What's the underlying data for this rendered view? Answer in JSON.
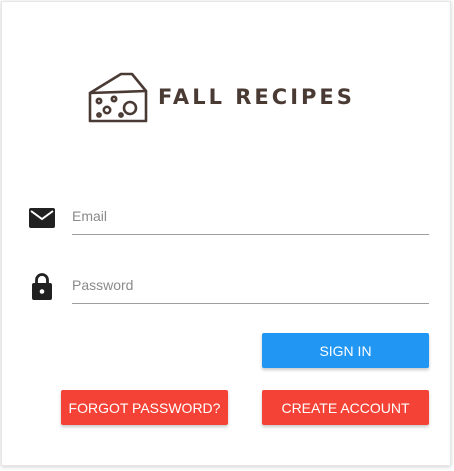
{
  "app": {
    "title": "FALL RECIPES",
    "logo_icon": "cheese-icon"
  },
  "form": {
    "email": {
      "placeholder": "Email",
      "value": "",
      "icon": "mail-icon"
    },
    "password": {
      "placeholder": "Password",
      "value": "",
      "icon": "lock-icon"
    }
  },
  "buttons": {
    "sign_in": "SIGN IN",
    "forgot_password": "FORGOT PASSWORD?",
    "create_account": "CREATE ACCOUNT"
  },
  "colors": {
    "primary": "#2196f3",
    "danger": "#f44336",
    "brand_text": "#4a3a34",
    "icon": "#212121"
  }
}
